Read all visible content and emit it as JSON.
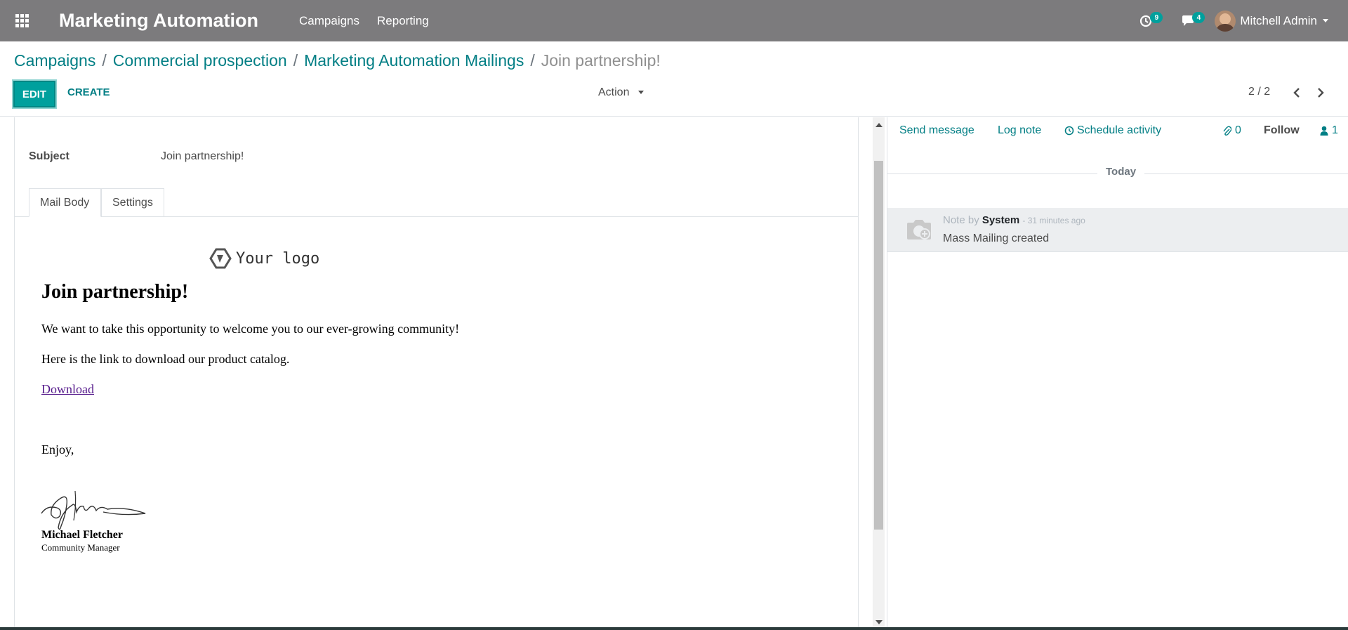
{
  "navbar": {
    "app_title": "Marketing Automation",
    "menu": [
      "Campaigns",
      "Reporting"
    ],
    "activity_count": "9",
    "message_count": "4",
    "user_name": "Mitchell Admin"
  },
  "breadcrumb": {
    "items": [
      "Campaigns",
      "Commercial prospection",
      "Marketing Automation Mailings"
    ],
    "current": "Join partnership!"
  },
  "toolbar": {
    "edit_label": "EDIT",
    "create_label": "CREATE",
    "action_label": "Action",
    "pager": "2 / 2"
  },
  "form": {
    "subject_label": "Subject",
    "subject_value": "Join partnership!",
    "tabs": [
      "Mail Body",
      "Settings"
    ],
    "active_tab": "Mail Body"
  },
  "mail": {
    "logo_text": "Your logo",
    "title": "Join partnership!",
    "para1": "We want to take this opportunity to welcome you to our ever-growing community!",
    "para2": "Here is the link to download our product catalog.",
    "link": "Download",
    "closing": "Enjoy,",
    "sig_name": "Michael Fletcher",
    "sig_role": "Community Manager"
  },
  "chatter": {
    "send_message": "Send message",
    "log_note": "Log note",
    "schedule_activity": "Schedule activity",
    "attachments_count": "0",
    "follow": "Follow",
    "followers_count": "1",
    "date_separator": "Today",
    "messages": [
      {
        "type_label": "Note by",
        "author": "System",
        "time": "- 31 minutes ago",
        "body": "Mass Mailing created"
      }
    ]
  },
  "colors": {
    "navbar": "#7c7b7d",
    "primary": "#00a09d",
    "link": "#017e84"
  }
}
